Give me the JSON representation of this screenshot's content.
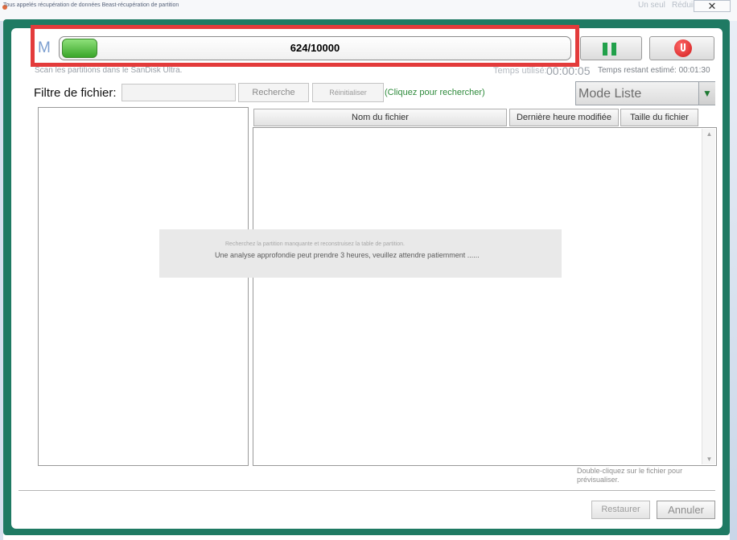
{
  "window": {
    "title": "Tous appelés récupération de données Beast-récupération de partition",
    "faint_buttons": [
      "Un seul",
      "Réduire"
    ],
    "close_glyph": "✕"
  },
  "scan": {
    "drive_letter": "M",
    "progress_text": "624/10000",
    "progress_current": 624,
    "progress_total": 10000,
    "progress_fill_fraction": 0.07,
    "status_text": "Scan les partitions dans le SanDisk Ultra.",
    "time_used_label": "Temps utilisé:",
    "time_used_value": "00:00:05",
    "time_remaining": "Temps restant estimé: 00:01:30",
    "pause_icon": "pause-icon",
    "stop_icon": "stop-icon",
    "accent_green": "#22a14b",
    "highlight_color": "#e33b3b"
  },
  "filter": {
    "label": "Filtre de fichier:",
    "input_value": "",
    "search_button": "Recherche",
    "reset_button": "Réinitialiser",
    "hint": "(Cliquez pour rechercher)",
    "mode_selected": "Mode Liste"
  },
  "table": {
    "columns": [
      "Nom du fichier",
      "Dernière heure modifiée",
      "Taille du fichier"
    ],
    "rows": []
  },
  "overlay": {
    "line1": "Recherchez la partition manquante et reconstruisez la table de partition.",
    "line2": "Une analyse approfondie peut prendre 3 heures, veuillez attendre patiemment ......"
  },
  "footer": {
    "preview_hint": "Double-cliquez sur le fichier pour prévisualiser.",
    "restore_button": "Restaurer",
    "cancel_button": "Annuler"
  }
}
